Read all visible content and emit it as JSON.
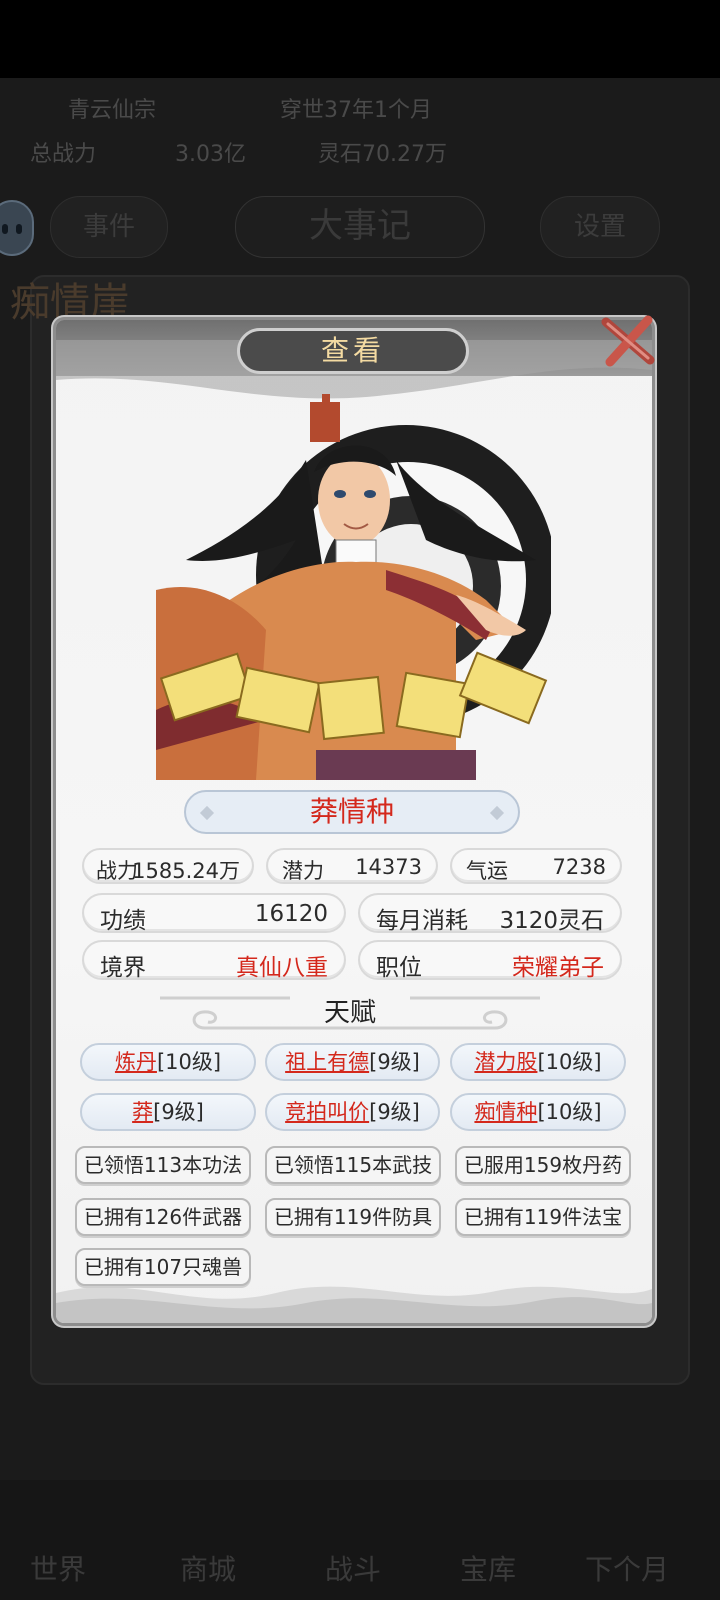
{
  "background": {
    "row1": [
      "青云仙宗",
      "穿世37年1个月"
    ],
    "row2": [
      "总战力",
      "3.03亿",
      "灵石70.27万"
    ],
    "tabs": [
      "事件",
      "大事记",
      "设置"
    ],
    "cliff_title": "痴情崖",
    "nav": [
      "世界",
      "商城",
      "战斗",
      "宝库",
      "下个月"
    ]
  },
  "modal": {
    "title": "查看",
    "name": "莽情种",
    "stats_row1": [
      {
        "label": "战力",
        "value": "1585.24万"
      },
      {
        "label": "潜力",
        "value": "14373"
      },
      {
        "label": "气运",
        "value": "7238"
      }
    ],
    "merit": {
      "label": "功绩",
      "value": "16120"
    },
    "monthly_cost": {
      "label": "每月消耗",
      "value": "3120灵石"
    },
    "realm": {
      "label": "境界",
      "value": "真仙八重"
    },
    "position": {
      "label": "职位",
      "value": "荣耀弟子"
    },
    "talent_header": "天赋",
    "talents": [
      {
        "name": "炼丹",
        "level": "[10级]"
      },
      {
        "name": "祖上有德",
        "level": "[9级]"
      },
      {
        "name": "潜力股",
        "level": "[10级]"
      },
      {
        "name": "莽",
        "level": "[9级]"
      },
      {
        "name": "竞拍叫价",
        "level": "[9级]"
      },
      {
        "name": "痴情种",
        "level": "[10级]"
      }
    ],
    "achievements": [
      "已领悟113本功法",
      "已领悟115本武技",
      "已服用159枚丹药",
      "已拥有126件武器",
      "已拥有119件防具",
      "已拥有119件法宝",
      "已拥有107只魂兽"
    ]
  },
  "colors": {
    "accent_red": "#d4281c",
    "title_gold": "#f4dba2"
  }
}
